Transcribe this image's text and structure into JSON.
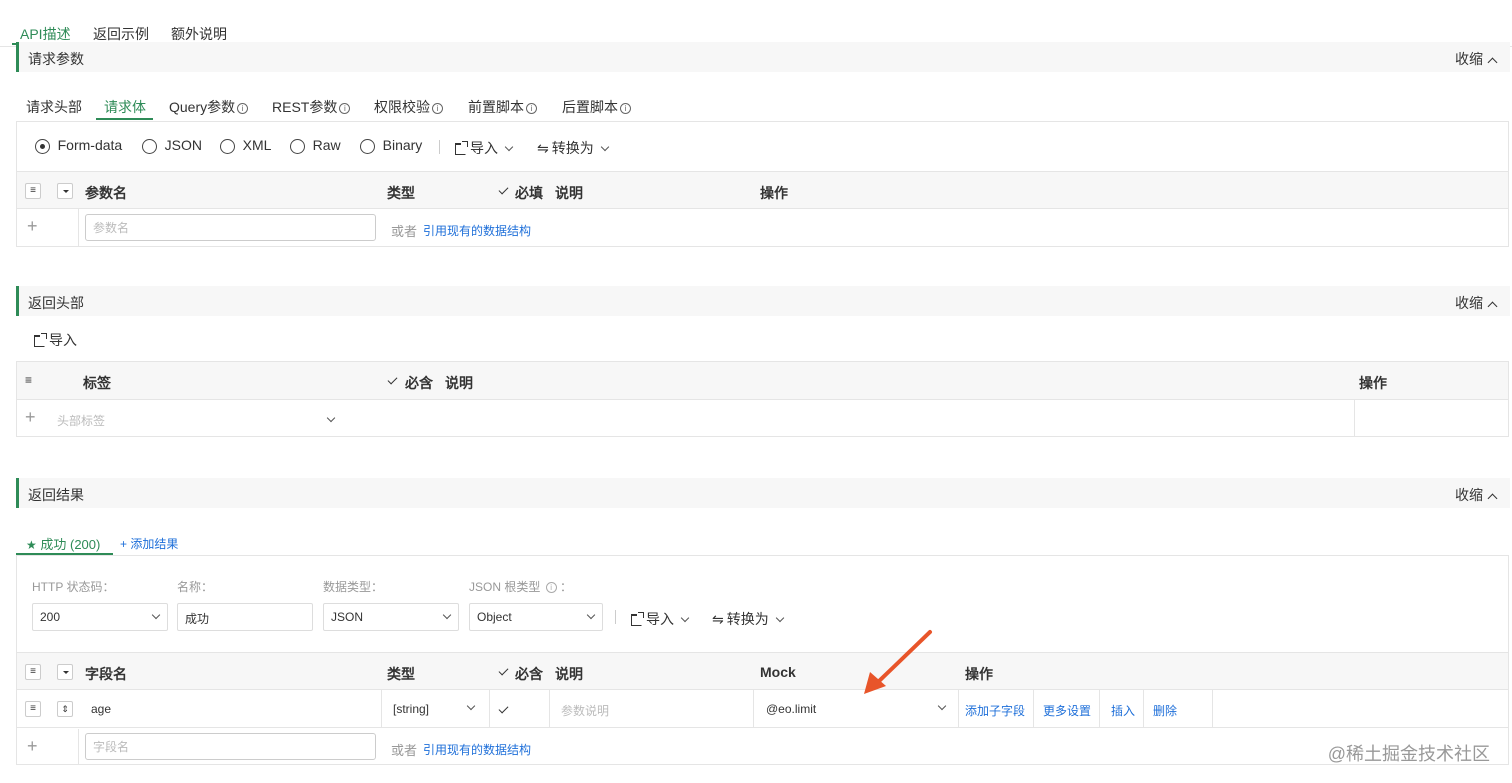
{
  "top_tabs": [
    "API描述",
    "返回示例",
    "额外说明"
  ],
  "sections": {
    "request": {
      "title": "请求参数",
      "collapse": "收缩"
    },
    "resp_header": {
      "title": "返回头部",
      "collapse": "收缩"
    },
    "resp_result": {
      "title": "返回结果",
      "collapse": "收缩"
    }
  },
  "request_tabs": [
    "请求头部",
    "请求体",
    "Query参数",
    "REST参数",
    "权限校验",
    "前置脚本",
    "后置脚本"
  ],
  "info_glyph": "i",
  "body_types": [
    "Form-data",
    "JSON",
    "XML",
    "Raw",
    "Binary"
  ],
  "toolbar": {
    "import": "导入",
    "convert": "转换为"
  },
  "req_table": {
    "headers": {
      "name": "参数名",
      "type": "类型",
      "required": "必填",
      "desc": "说明",
      "op": "操作"
    },
    "name_placeholder": "参数名",
    "or": "或者",
    "ref_link": "引用现有的数据结构"
  },
  "resp_header_table": {
    "import": "导入",
    "headers": {
      "label": "标签",
      "required": "必含",
      "desc": "说明",
      "op": "操作"
    },
    "label_placeholder": "头部标签"
  },
  "result": {
    "tab_label": "成功 (200)",
    "add_result": "+ 添加结果",
    "fields": {
      "status_label": "HTTP 状态码：",
      "name_label": "名称：",
      "datatype_label": "数据类型：",
      "root_label": "JSON 根类型",
      "root_colon": "：",
      "status_value": "200",
      "name_value": "成功",
      "datatype_value": "JSON",
      "root_value": "Object"
    },
    "table": {
      "headers": {
        "field": "字段名",
        "type": "类型",
        "required": "必含",
        "desc": "说明",
        "mock": "Mock",
        "op": "操作"
      },
      "row": {
        "field": "age",
        "type": "[string]",
        "desc_placeholder": "参数说明",
        "mock": "@eo.limit",
        "actions": [
          "添加子字段",
          "更多设置",
          "插入",
          "删除"
        ]
      },
      "field_placeholder": "字段名",
      "or": "或者",
      "ref_link": "引用现有的数据结构"
    }
  },
  "watermark": "@稀土掘金技术社区",
  "colors": {
    "accent": "#2e8b57",
    "link": "#1e6fd9",
    "arrow": "#e8552a"
  }
}
